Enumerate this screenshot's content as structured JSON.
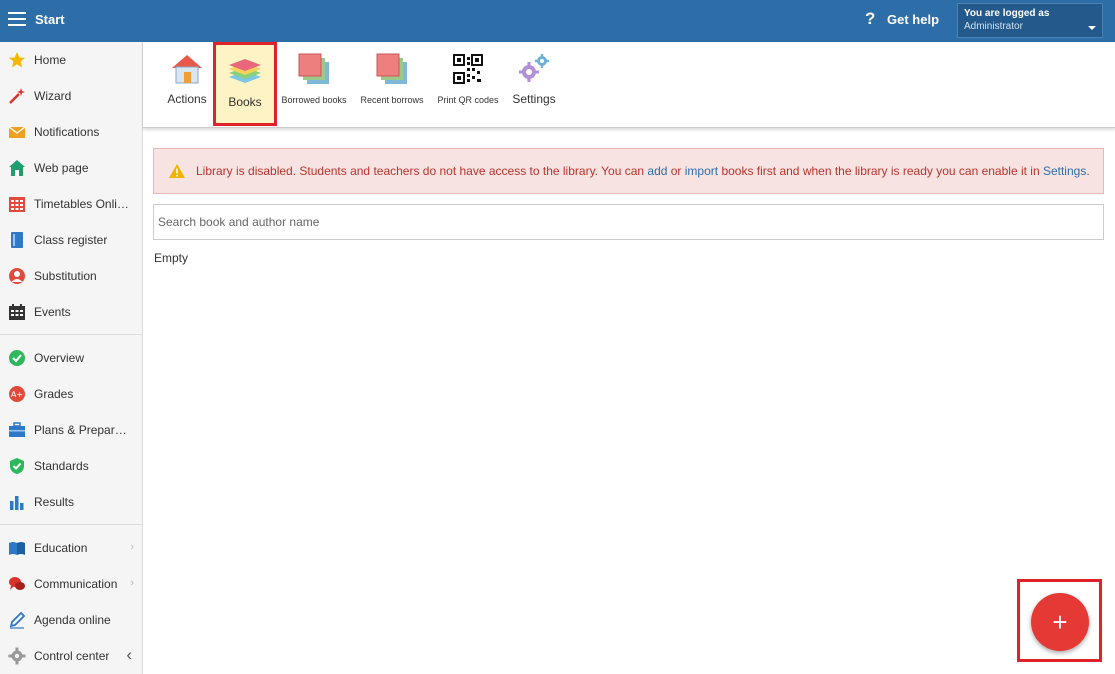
{
  "header": {
    "title": "Start",
    "help_label": "Get help",
    "login_line1": "You are logged as",
    "login_user": "Administrator"
  },
  "sidebar": {
    "items": [
      {
        "label": "Home",
        "icon": "star-icon"
      },
      {
        "label": "Wizard",
        "icon": "wand-icon"
      },
      {
        "label": "Notifications",
        "icon": "envelope-icon"
      },
      {
        "label": "Web page",
        "icon": "house-icon"
      },
      {
        "label": "Timetables Online",
        "icon": "calendar-grid-icon"
      },
      {
        "label": "Class register",
        "icon": "book-icon"
      },
      {
        "label": "Substitution",
        "icon": "person-icon"
      },
      {
        "label": "Events",
        "icon": "calendar-icon"
      },
      {
        "label": "Overview",
        "icon": "check-circle-icon"
      },
      {
        "label": "Grades",
        "icon": "grades-icon"
      },
      {
        "label": "Plans & Preparations",
        "icon": "briefcase-icon"
      },
      {
        "label": "Standards",
        "icon": "shield-check-icon"
      },
      {
        "label": "Results",
        "icon": "bar-chart-icon"
      },
      {
        "label": "Education",
        "icon": "open-book-icon"
      },
      {
        "label": "Communication",
        "icon": "chat-icon"
      },
      {
        "label": "Agenda online",
        "icon": "pen-icon"
      },
      {
        "label": "Control center",
        "icon": "gear-icon"
      }
    ]
  },
  "toolbar": {
    "actions": "Actions",
    "books": "Books",
    "borrowed": "Borrowed books",
    "recent": "Recent borrows",
    "qr": "Print QR codes",
    "settings": "Settings"
  },
  "alert": {
    "part1": "Library is disabled. Students and teachers do not have access to the library. You can ",
    "link_add": "add",
    "part2": " or ",
    "link_import": "import",
    "part3": " books first and when the library is ready you can enable it in ",
    "link_settings": "Settings",
    "part4": "."
  },
  "search": {
    "placeholder": "Search book and author name"
  },
  "content": {
    "empty": "Empty"
  },
  "fab": {
    "label": "+"
  },
  "colors": {
    "header_bg": "#2d6ea8",
    "alert_bg": "#f7e3e2",
    "alert_text": "#b8342c",
    "fab": "#e53935",
    "highlight": "#e0232b"
  }
}
